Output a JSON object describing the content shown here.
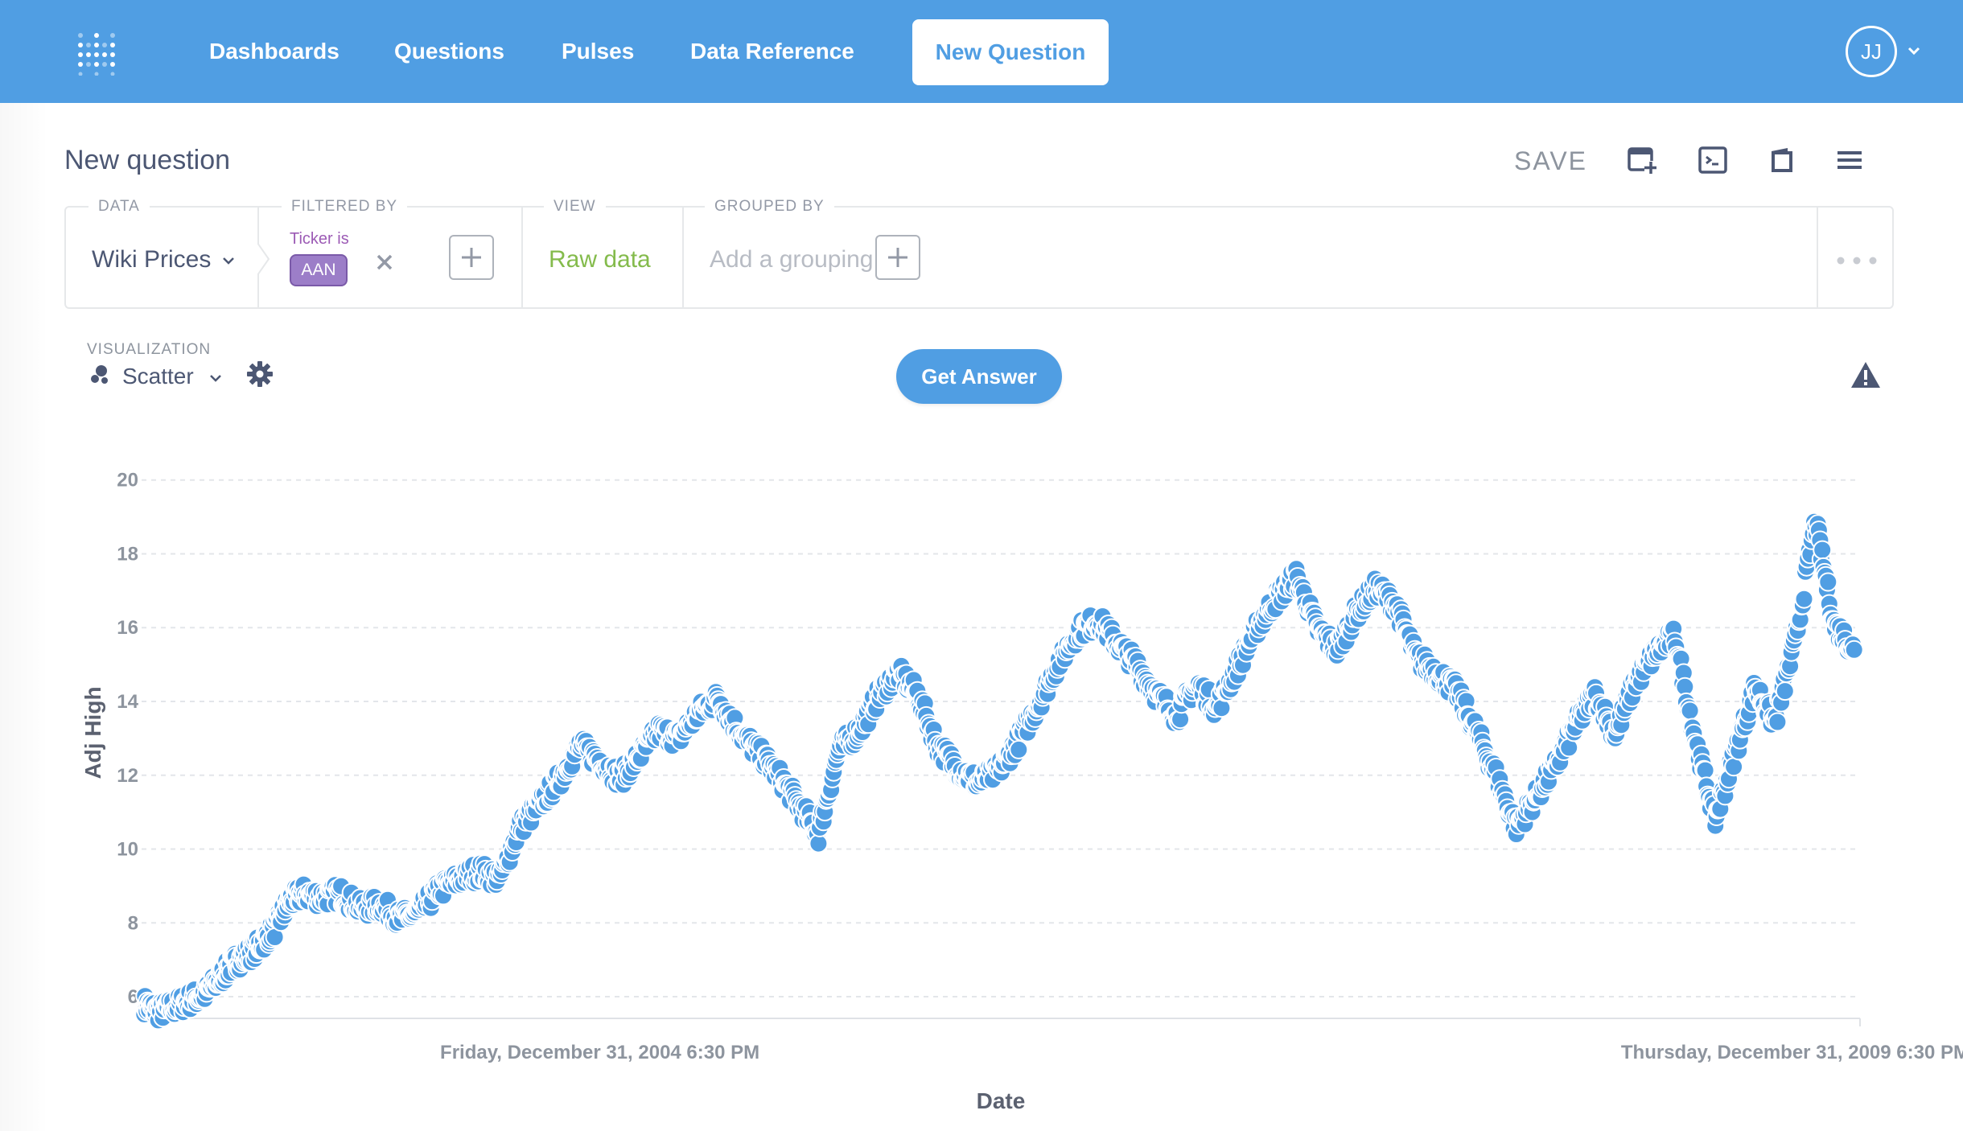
{
  "nav": {
    "links": [
      "Dashboards",
      "Questions",
      "Pulses",
      "Data Reference"
    ],
    "new_question": "New Question",
    "avatar_initials": "JJ",
    "logo_icon": "metabase-logo-icon",
    "brand_color": "#509ee3"
  },
  "header": {
    "title": "New question",
    "save_label": "SAVE",
    "icons": [
      "add-to-dashboard-icon",
      "sql-editor-icon",
      "reference-book-icon",
      "menu-icon"
    ]
  },
  "query_builder": {
    "data_label": "DATA",
    "database": "Wiki Prices",
    "filtered_by_label": "FILTERED BY",
    "filter_field": "Ticker is",
    "filter_value": "AAN",
    "view_label": "VIEW",
    "view_value": "Raw data",
    "grouped_by_label": "GROUPED BY",
    "grouping_placeholder": "Add a grouping"
  },
  "visualization": {
    "label": "VISUALIZATION",
    "type": "Scatter",
    "button": "Get Answer"
  },
  "chart_data": {
    "type": "scatter",
    "xlabel": "Date",
    "ylabel": "Adj High",
    "ylim": [
      5.5,
      20.8
    ],
    "yticks": [
      6,
      8,
      10,
      12,
      14,
      16,
      18,
      20
    ],
    "xrange": [
      "2003-02-01",
      "2010-04-10"
    ],
    "xticks": [
      {
        "date": "2005-01-01",
        "label": "Friday, December 31, 2004 6:30 PM"
      },
      {
        "date": "2010-01-01",
        "label": "Thursday, December 31, 2009 6:30 PM"
      }
    ],
    "grid": "horizontal dashed",
    "marker_color": "#509ee3",
    "series": [
      {
        "points": [
          [
            "2003-02-05",
            5.8
          ],
          [
            "2003-02-25",
            5.6
          ],
          [
            "2003-03-20",
            5.7
          ],
          [
            "2003-04-15",
            5.9
          ],
          [
            "2003-05-10",
            6.1
          ],
          [
            "2003-06-01",
            6.5
          ],
          [
            "2003-06-20",
            6.9
          ],
          [
            "2003-07-10",
            7.1
          ],
          [
            "2003-08-01",
            7.4
          ],
          [
            "2003-08-25",
            7.9
          ],
          [
            "2003-09-15",
            8.6
          ],
          [
            "2003-10-05",
            8.8
          ],
          [
            "2003-11-01",
            8.7
          ],
          [
            "2003-12-01",
            8.8
          ],
          [
            "2004-01-01",
            8.4
          ],
          [
            "2004-02-01",
            8.5
          ],
          [
            "2004-03-01",
            8.1
          ],
          [
            "2004-04-01",
            8.3
          ],
          [
            "2004-05-01",
            8.9
          ],
          [
            "2004-06-01",
            9.2
          ],
          [
            "2004-07-01",
            9.4
          ],
          [
            "2004-08-01",
            9.2
          ],
          [
            "2004-09-01",
            10.6
          ],
          [
            "2004-10-01",
            11.2
          ],
          [
            "2004-11-01",
            11.9
          ],
          [
            "2004-12-01",
            12.8
          ],
          [
            "2005-01-01",
            12.4
          ],
          [
            "2005-02-01",
            11.9
          ],
          [
            "2005-03-01",
            12.5
          ],
          [
            "2005-04-01",
            13.2
          ],
          [
            "2005-05-01",
            13.0
          ],
          [
            "2005-06-01",
            13.7
          ],
          [
            "2005-07-01",
            14.1
          ],
          [
            "2005-08-01",
            13.2
          ],
          [
            "2005-09-01",
            12.6
          ],
          [
            "2005-10-01",
            12.0
          ],
          [
            "2005-11-01",
            11.2
          ],
          [
            "2005-12-01",
            10.4
          ],
          [
            "2006-01-01",
            12.7
          ],
          [
            "2006-02-01",
            13.2
          ],
          [
            "2006-03-01",
            14.1
          ],
          [
            "2006-04-01",
            14.8
          ],
          [
            "2006-05-01",
            14.2
          ],
          [
            "2006-06-01",
            12.8
          ],
          [
            "2006-07-01",
            12.2
          ],
          [
            "2006-08-01",
            11.8
          ],
          [
            "2006-09-01",
            12.1
          ],
          [
            "2006-10-01",
            12.9
          ],
          [
            "2006-11-01",
            13.9
          ],
          [
            "2006-12-01",
            15.0
          ],
          [
            "2007-01-01",
            15.9
          ],
          [
            "2007-02-01",
            16.2
          ],
          [
            "2007-03-01",
            15.6
          ],
          [
            "2007-04-01",
            15.0
          ],
          [
            "2007-05-01",
            14.2
          ],
          [
            "2007-06-01",
            13.6
          ],
          [
            "2007-07-01",
            14.5
          ],
          [
            "2007-08-01",
            13.8
          ],
          [
            "2007-09-01",
            14.9
          ],
          [
            "2007-10-01",
            16.0
          ],
          [
            "2007-11-01",
            16.8
          ],
          [
            "2007-12-01",
            17.4
          ],
          [
            "2008-01-01",
            16.0
          ],
          [
            "2008-02-01",
            15.4
          ],
          [
            "2008-03-01",
            16.4
          ],
          [
            "2008-04-01",
            17.1
          ],
          [
            "2008-05-01",
            16.6
          ],
          [
            "2008-06-01",
            15.2
          ],
          [
            "2008-07-01",
            14.8
          ],
          [
            "2008-08-01",
            14.3
          ],
          [
            "2008-09-01",
            13.2
          ],
          [
            "2008-10-01",
            12.0
          ],
          [
            "2008-11-01",
            10.6
          ],
          [
            "2008-12-01",
            11.4
          ],
          [
            "2009-01-01",
            12.3
          ],
          [
            "2009-02-01",
            13.4
          ],
          [
            "2009-03-01",
            14.2
          ],
          [
            "2009-04-01",
            13.1
          ],
          [
            "2009-05-01",
            14.5
          ],
          [
            "2009-06-01",
            15.3
          ],
          [
            "2009-07-01",
            15.8
          ],
          [
            "2009-08-01",
            13.0
          ],
          [
            "2009-09-01",
            10.8
          ],
          [
            "2009-10-01",
            12.6
          ],
          [
            "2009-11-01",
            14.4
          ],
          [
            "2009-12-01",
            13.4
          ],
          [
            "2010-01-01",
            15.6
          ],
          [
            "2010-02-01",
            18.9
          ],
          [
            "2010-03-01",
            16.1
          ],
          [
            "2010-04-01",
            15.4
          ]
        ]
      }
    ]
  }
}
